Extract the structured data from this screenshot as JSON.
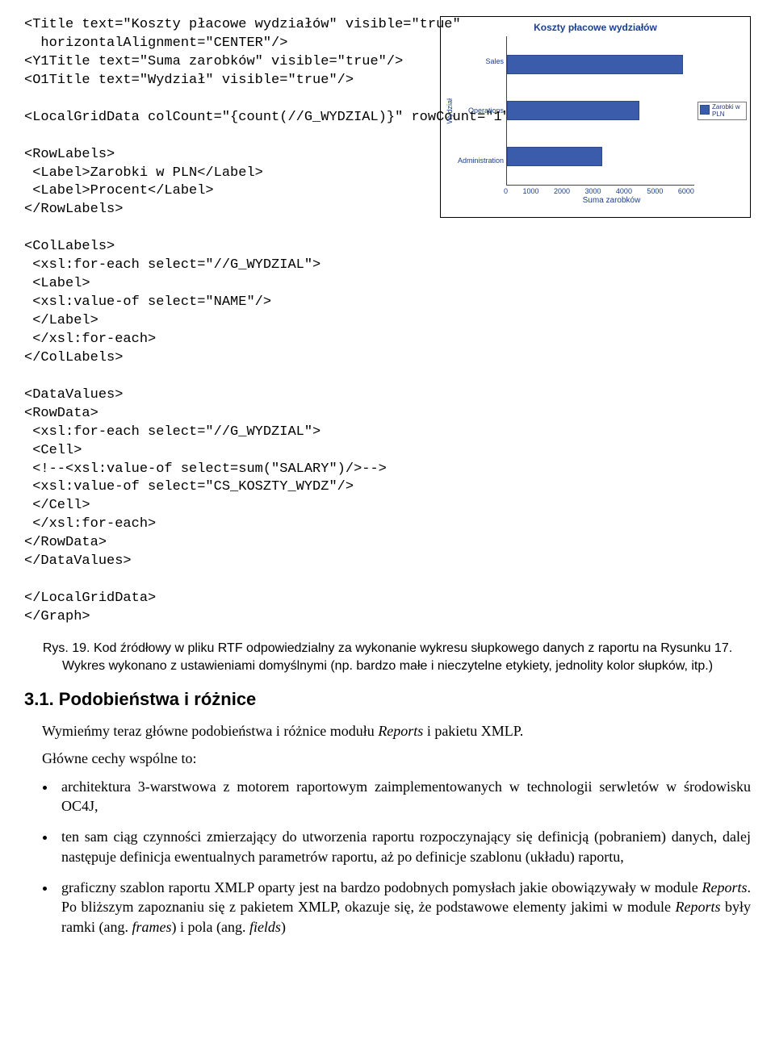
{
  "code_block": "<Title text=\"Koszty płacowe wydziałów\" visible=\"true\"\n  horizontalAlignment=\"CENTER\"/>\n<Y1Title text=\"Suma zarobków\" visible=\"true\"/>\n<O1Title text=\"Wydział\" visible=\"true\"/>\n\n<LocalGridData colCount=\"{count(//G_WYDZIAL)}\" rowCount=\"1\">\n\n<RowLabels>\n <Label>Zarobki w PLN</Label>\n <Label>Procent</Label>\n</RowLabels>\n\n<ColLabels>\n <xsl:for-each select=\"//G_WYDZIAL\">\n <Label>\n <xsl:value-of select=\"NAME\"/>\n </Label>\n </xsl:for-each>\n</ColLabels>\n\n<DataValues>\n<RowData>\n <xsl:for-each select=\"//G_WYDZIAL\">\n <Cell>\n <!--<xsl:value-of select=sum(\"SALARY\")/>-->\n <xsl:value-of select=\"CS_KOSZTY_WYDZ\"/>\n </Cell>\n </xsl:for-each>\n</RowData>\n</DataValues>\n\n</LocalGridData>\n</Graph>",
  "chart_data": {
    "type": "bar",
    "orientation": "horizontal",
    "title": "Koszty płacowe wydziałów",
    "xlabel": "Suma zarobków",
    "ylabel": "Wydział",
    "categories": [
      "Sales",
      "Operations",
      "Administration"
    ],
    "series": [
      {
        "name": "Zarobki w PLN",
        "values": [
          5600,
          4200,
          3000
        ]
      }
    ],
    "xlim": [
      0,
      6000
    ],
    "xticks": [
      0,
      1000,
      2000,
      3000,
      4000,
      5000,
      6000
    ],
    "legend_entries": [
      "Zarobki w PLN"
    ]
  },
  "caption": "Rys. 19. Kod źródłowy w pliku RTF odpowiedzialny za wykonanie wykresu słupkowego danych z raportu na Rysunku 17. Wykres wykonano z ustawieniami domyślnymi (np. bardzo małe i nieczytelne etykiety, jednolity kolor słupków, itp.)",
  "heading": "3.1. Podobieństwa i różnice",
  "para1": "Wymieńmy teraz główne podobieństwa i różnice modułu ",
  "para1_ital": "Reports",
  "para1_tail": " i pakietu XMLP.",
  "para2": "Główne cechy wspólne to:",
  "bullets": [
    "architektura 3-warstwowa z motorem raportowym zaimplementowanych w technologii serwletów w środowisku OC4J,",
    "ten sam ciąg czynności zmierzający do utworzenia raportu rozpoczynający się definicją (pobraniem) danych, dalej następuje definicja ewentualnych parametrów raportu, aż po definicje szablonu (układu) raportu,"
  ],
  "bullet3_a": "graficzny szablon raportu XMLP oparty jest na bardzo podobnych pomysłach jakie obowiązywały w module ",
  "bullet3_b": "Reports",
  "bullet3_c": ". Po bliższym zapoznaniu się z pakietem XMLP, okazuje się, że podstawowe elementy jakimi w module ",
  "bullet3_d": "Reports",
  "bullet3_e": " były ramki (ang. ",
  "bullet3_f": "frames",
  "bullet3_g": ") i pola (ang. ",
  "bullet3_h": "fields",
  "bullet3_i": ")"
}
